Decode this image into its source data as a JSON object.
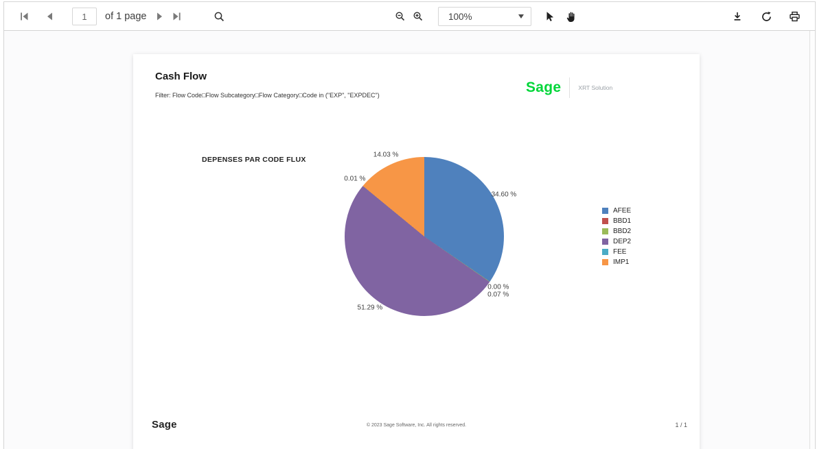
{
  "toolbar": {
    "page_input_value": "1",
    "pages_label": "of 1 page",
    "zoom_level": "100%",
    "icons": [
      "first-page",
      "previous-page",
      "next-page",
      "last-page",
      "search",
      "zoom-out",
      "zoom-in",
      "pointer-select",
      "pan-hand",
      "download",
      "refresh",
      "print"
    ]
  },
  "report": {
    "title": "Cash Flow",
    "filter_line": "Filter: Flow Code□Flow Subcategory□Flow Category□Code in (\"EXP\", \"EXPDEC\")",
    "brand": {
      "logo_text": "Sage",
      "logo_color": "#00d639",
      "product_label": "XRT Solution"
    },
    "footer": {
      "logo_text": "Sage",
      "copyright": "© 2023 Sage Software, Inc. All rights reserved.",
      "page_indicator": "1 / 1"
    }
  },
  "chart_data": {
    "type": "pie",
    "title": "DEPENSES PAR CODE FLUX",
    "legend_position": "right",
    "direction": "clockwise",
    "start_angle_deg": 0,
    "unit": "%",
    "slices": [
      {
        "label": "AFEE",
        "value": 34.6,
        "display": "34.60 %",
        "color": "#4f81bd"
      },
      {
        "label": "BBD1",
        "value": 0.0,
        "display": "0.00 %",
        "color": "#c0504d"
      },
      {
        "label": "BBD2",
        "value": 0.07,
        "display": "0.07 %",
        "color": "#9bbb59"
      },
      {
        "label": "DEP2",
        "value": 51.29,
        "display": "51.29 %",
        "color": "#8064a2"
      },
      {
        "label": "FEE",
        "value": 0.01,
        "display": "0.01 %",
        "color": "#4bacc6"
      },
      {
        "label": "IMP1",
        "value": 14.03,
        "display": "14.03 %",
        "color": "#f79646"
      }
    ]
  }
}
